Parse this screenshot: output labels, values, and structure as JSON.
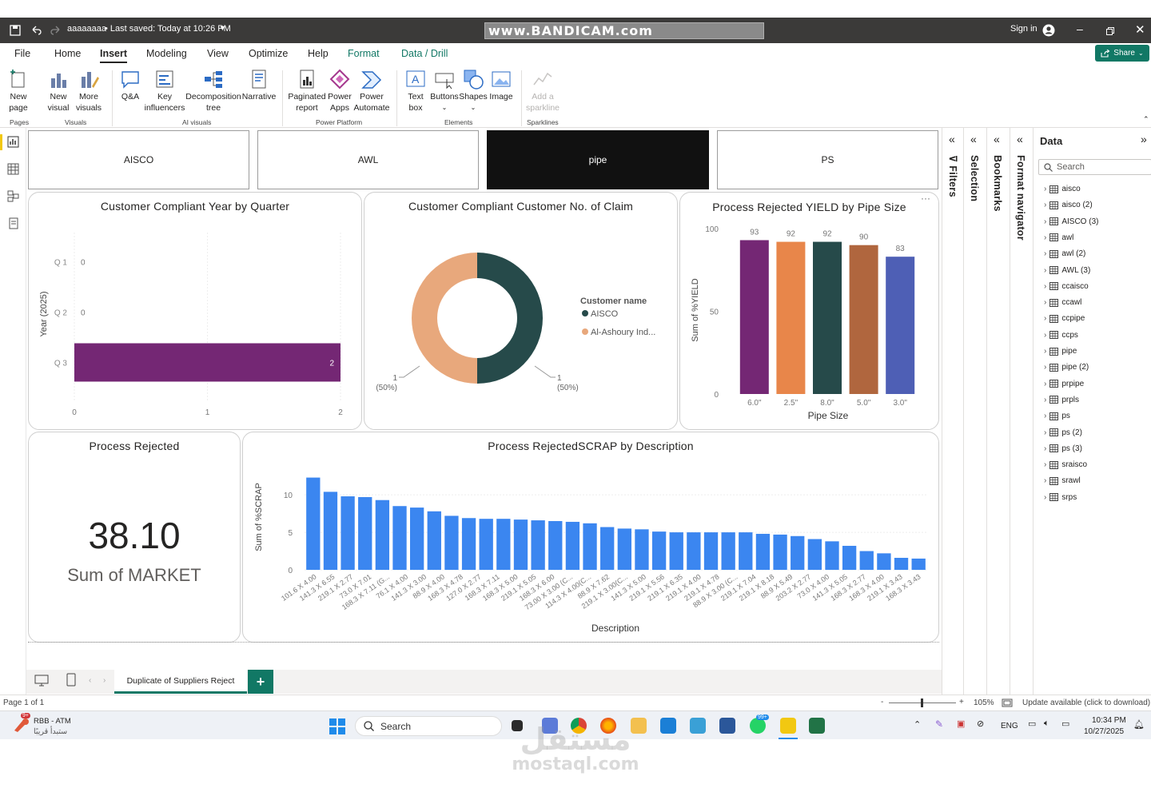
{
  "titlebar": {
    "file_name": "aaaaaaaa",
    "saved": "• Last saved: Today at 10:26 PM",
    "bandicam": "www.BANDICAM.com",
    "sign_in": "Sign in"
  },
  "menu": {
    "items": [
      "File",
      "Home",
      "Insert",
      "Modeling",
      "View",
      "Optimize",
      "Help",
      "Format",
      "Data / Drill"
    ],
    "active": "Insert",
    "share": "Share"
  },
  "ribbon": {
    "buttons": [
      {
        "label": "New\npage",
        "name": "new-page"
      },
      {
        "label": "New\nvisual",
        "name": "new-visual"
      },
      {
        "label": "More\nvisuals",
        "name": "more-visuals"
      },
      {
        "label": "Q&A",
        "name": "qna"
      },
      {
        "label": "Key\ninfluencers",
        "name": "key-influencers"
      },
      {
        "label": "Decomposition\ntree",
        "name": "decomposition-tree"
      },
      {
        "label": "Narrative",
        "name": "narrative"
      },
      {
        "label": "Paginated\nreport",
        "name": "paginated-report"
      },
      {
        "label": "Power\nApps",
        "name": "power-apps"
      },
      {
        "label": "Power\nAutomate",
        "name": "power-automate"
      },
      {
        "label": "Text\nbox",
        "name": "text-box"
      },
      {
        "label": "Buttons",
        "name": "buttons"
      },
      {
        "label": "Shapes",
        "name": "shapes"
      },
      {
        "label": "Image",
        "name": "image"
      },
      {
        "label": "Add a\nsparkline",
        "name": "add-sparkline"
      }
    ],
    "groups": [
      "Pages",
      "Visuals",
      "AI visuals",
      "Power Platform",
      "Elements",
      "Sparklines"
    ]
  },
  "slicers": [
    "AISCO",
    "AWL",
    "pipe",
    "PS"
  ],
  "visual1": {
    "title": "Customer Compliant Year by Quarter"
  },
  "visual2": {
    "title": "Customer Compliant Customer No. of Claim",
    "legend_title": "Customer name"
  },
  "visual3": {
    "title": "Process Rejected YIELD by Pipe Size"
  },
  "card": {
    "title": "Process Rejected",
    "value": "38.10",
    "label": "Sum of MARKET"
  },
  "visual5": {
    "title": "Process RejectedSCRAP by Description"
  },
  "chart_data": [
    {
      "type": "bar",
      "orientation": "horizontal",
      "categories": [
        "Q 1",
        "Q 2",
        "Q 3"
      ],
      "values": [
        0,
        0,
        2
      ],
      "ylabel": "Year (2025)",
      "xlim": [
        0,
        2
      ],
      "xticks": [
        "0",
        "1",
        "2"
      ],
      "color": "#742774"
    },
    {
      "type": "pie",
      "donut": true,
      "legend_title": "Customer name",
      "slices": [
        {
          "name": "AISCO",
          "value": 1,
          "pct": "(50%)",
          "color": "#264a4a"
        },
        {
          "name": "Al-Ashoury Ind...",
          "value": 1,
          "pct": "(50%)",
          "color": "#e8a87c"
        }
      ]
    },
    {
      "type": "bar",
      "categories": [
        "6.0\"",
        "2.5\"",
        "8.0\"",
        "5.0\"",
        "3.0\""
      ],
      "values": [
        93,
        92,
        92,
        90,
        83
      ],
      "colors": [
        "#742774",
        "#e8864a",
        "#264a4a",
        "#b0663e",
        "#4e5fb5"
      ],
      "xlabel": "Pipe Size",
      "ylabel": "Sum of %YIELD",
      "ylim": [
        0,
        100
      ],
      "yticks": [
        "0",
        "50",
        "100"
      ]
    },
    {
      "type": "bar",
      "categories": [
        "101.6 X 4.00",
        "141.3 X 6.55",
        "219.1 X 2.77",
        "73.0 X 7.01",
        "168.3 X 7.11 (G...",
        "76.1 X 4.00",
        "141.3 X 3.00",
        "88.9 X 4.00",
        "168.3 X 4.78",
        "127.0 X 2.77",
        "168.3 X 7.11",
        "168.3 X 5.00",
        "219.1 X 5.05",
        "168.3 X 6.00",
        "73.00 X 3.00 (C...",
        "114.3 X 4.00(C...",
        "88.9 X 7.62",
        "219.1 X 3.00(C...",
        "141.3 X 5.00",
        "219.1 X 5.56",
        "219.1 X 6.35",
        "219.1 X 4.00",
        "219.1 X 4.78",
        "88.9 X 3.00 (C...",
        "219.1 X 7.04",
        "219.1 X 8.18",
        "88.9 X 5.49",
        "203.2 X 2.77",
        "73.0 X 4.00",
        "141.3 X 5.05",
        "168.3 X 2.77",
        "168.3 X 4.00",
        "219.1 X 3.43",
        "168.3 X 3.43"
      ],
      "values": [
        12.3,
        10.4,
        9.8,
        9.7,
        9.3,
        8.5,
        8.3,
        7.8,
        7.2,
        6.9,
        6.8,
        6.8,
        6.7,
        6.6,
        6.5,
        6.4,
        6.2,
        5.7,
        5.5,
        5.4,
        5.1,
        5.0,
        5.0,
        5.0,
        5.0,
        5.0,
        4.8,
        4.7,
        4.5,
        4.1,
        3.8,
        3.2,
        2.5,
        2.2,
        1.6,
        1.5
      ],
      "xlabel": "Description",
      "ylabel": "Sum of %SCRAP",
      "ylim": [
        0,
        13
      ],
      "yticks": [
        "0",
        "5",
        "10"
      ],
      "color": "#3b86f0"
    }
  ],
  "panes": {
    "filters": "Filters",
    "selection": "Selection",
    "bookmarks": "Bookmarks",
    "format_navigator": "Format navigator",
    "data": "Data",
    "search_placeholder": "Search"
  },
  "data_tables": [
    "aisco",
    "aisco (2)",
    "AISCO (3)",
    "awl",
    "awl (2)",
    "AWL (3)",
    "ccaisco",
    "ccawl",
    "ccpipe",
    "ccps",
    "pipe",
    "pipe (2)",
    "prpipe",
    "prpls",
    "ps",
    "ps (2)",
    "ps (3)",
    "sraisco",
    "srawl",
    "srps"
  ],
  "pagebar": {
    "tab": "Duplicate of Suppliers Reject",
    "add": "+"
  },
  "status": {
    "page": "Page 1 of 1",
    "zoom": "105%",
    "update": "Update available (click to download)"
  },
  "taskbar": {
    "weather_title": "RBB - ATM",
    "weather_sub": "ستبدأ قريبًا",
    "search": "Search",
    "lang": "ENG",
    "time": "10:34 PM",
    "date": "10/27/2025",
    "badge1": "9+",
    "badge2": "99+"
  },
  "watermark": {
    "arabic": "مستقل",
    "latin": "mostaql.com"
  }
}
